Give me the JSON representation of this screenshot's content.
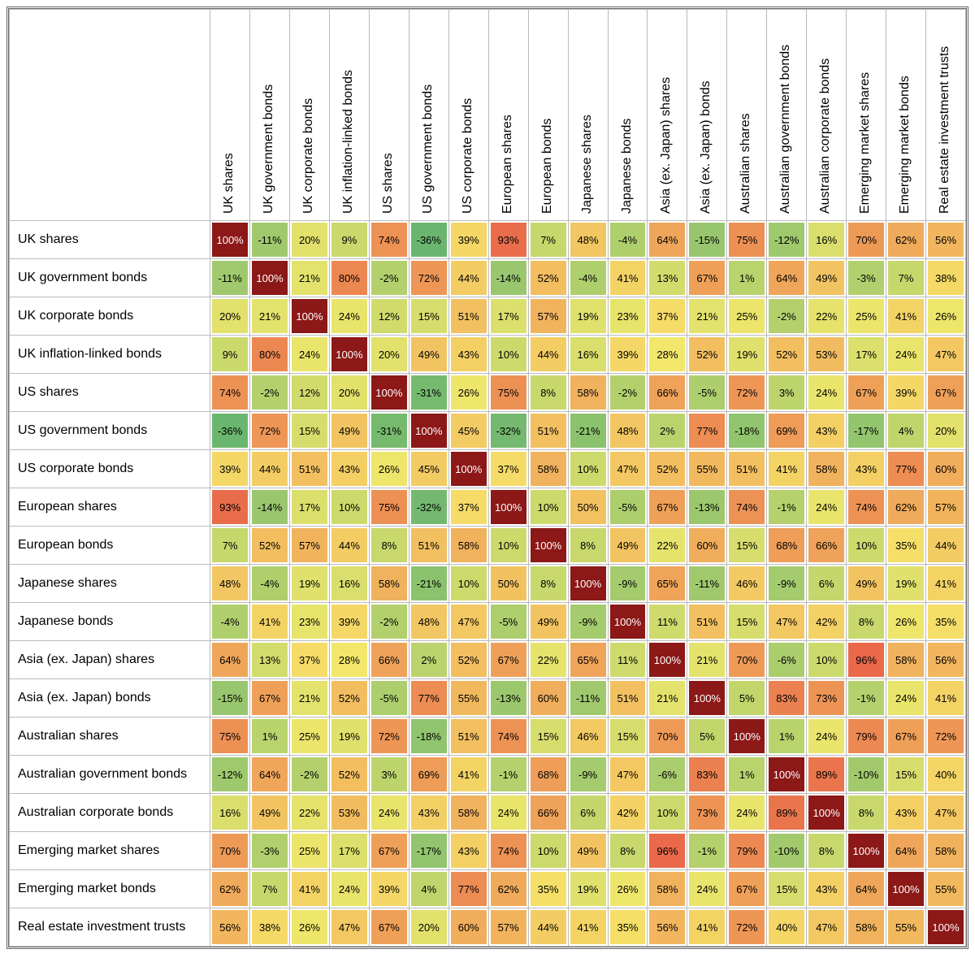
{
  "chart_data": {
    "type": "heatmap",
    "title": "",
    "labels": [
      "UK shares",
      "UK government bonds",
      "UK corporate bonds",
      "UK inflation-linked bonds",
      "US shares",
      "US government bonds",
      "US corporate bonds",
      "European shares",
      "European bonds",
      "Japanese shares",
      "Japanese bonds",
      "Asia (ex. Japan) shares",
      "Asia (ex. Japan) bonds",
      "Australian shares",
      "Australian government bonds",
      "Australian corporate bonds",
      "Emerging market shares",
      "Emerging market bonds",
      "Real estate investment trusts"
    ],
    "matrix": [
      [
        100,
        -11,
        20,
        9,
        74,
        -36,
        39,
        93,
        7,
        48,
        -4,
        64,
        -15,
        75,
        -12,
        16,
        70,
        62,
        56
      ],
      [
        -11,
        100,
        21,
        80,
        -2,
        72,
        44,
        -14,
        52,
        -4,
        41,
        13,
        67,
        1,
        64,
        49,
        -3,
        7,
        38
      ],
      [
        20,
        21,
        100,
        24,
        12,
        15,
        51,
        17,
        57,
        19,
        23,
        37,
        21,
        25,
        -2,
        22,
        25,
        41,
        26
      ],
      [
        9,
        80,
        24,
        100,
        20,
        49,
        43,
        10,
        44,
        16,
        39,
        28,
        52,
        19,
        52,
        53,
        17,
        24,
        47
      ],
      [
        74,
        -2,
        12,
        20,
        100,
        -31,
        26,
        75,
        8,
        58,
        -2,
        66,
        -5,
        72,
        3,
        24,
        67,
        39,
        67
      ],
      [
        -36,
        72,
        15,
        49,
        -31,
        100,
        45,
        -32,
        51,
        -21,
        48,
        2,
        77,
        -18,
        69,
        43,
        -17,
        4,
        20
      ],
      [
        39,
        44,
        51,
        43,
        26,
        45,
        100,
        37,
        58,
        10,
        47,
        52,
        55,
        51,
        41,
        58,
        43,
        77,
        60
      ],
      [
        93,
        -14,
        17,
        10,
        75,
        -32,
        37,
        100,
        10,
        50,
        -5,
        67,
        -13,
        74,
        -1,
        24,
        74,
        62,
        57
      ],
      [
        7,
        52,
        57,
        44,
        8,
        51,
        58,
        10,
        100,
        8,
        49,
        22,
        60,
        15,
        68,
        66,
        10,
        35,
        44
      ],
      [
        48,
        -4,
        19,
        16,
        58,
        -21,
        10,
        50,
        8,
        100,
        -9,
        65,
        -11,
        46,
        -9,
        6,
        49,
        19,
        41
      ],
      [
        -4,
        41,
        23,
        39,
        -2,
        48,
        47,
        -5,
        49,
        -9,
        100,
        11,
        51,
        15,
        47,
        42,
        8,
        26,
        35
      ],
      [
        64,
        13,
        37,
        28,
        66,
        2,
        52,
        67,
        22,
        65,
        11,
        100,
        21,
        70,
        -6,
        10,
        96,
        58,
        56
      ],
      [
        -15,
        67,
        21,
        52,
        -5,
        77,
        55,
        -13,
        60,
        -11,
        51,
        21,
        100,
        5,
        83,
        73,
        -1,
        24,
        41
      ],
      [
        75,
        1,
        25,
        19,
        72,
        -18,
        51,
        74,
        15,
        46,
        15,
        70,
        5,
        100,
        1,
        24,
        79,
        67,
        72
      ],
      [
        -12,
        64,
        -2,
        52,
        3,
        69,
        41,
        -1,
        68,
        -9,
        47,
        -6,
        83,
        1,
        100,
        89,
        -10,
        15,
        40
      ],
      [
        16,
        49,
        22,
        53,
        24,
        43,
        58,
        24,
        66,
        6,
        42,
        10,
        73,
        24,
        89,
        100,
        8,
        43,
        47
      ],
      [
        70,
        -3,
        25,
        17,
        67,
        -17,
        43,
        74,
        10,
        49,
        8,
        96,
        -1,
        79,
        -10,
        8,
        100,
        64,
        58
      ],
      [
        62,
        7,
        41,
        24,
        39,
        4,
        77,
        62,
        35,
        19,
        26,
        58,
        24,
        67,
        15,
        43,
        64,
        100,
        55
      ],
      [
        56,
        38,
        26,
        47,
        67,
        20,
        60,
        57,
        44,
        41,
        35,
        56,
        41,
        72,
        40,
        47,
        58,
        55,
        100
      ]
    ],
    "value_suffix": "%",
    "scale_min": -40,
    "scale_max": 100,
    "color_low": "#63b36f",
    "color_mid": "#f6e96b",
    "color_high": "#e9694a",
    "color_diag": "#8c1818"
  }
}
